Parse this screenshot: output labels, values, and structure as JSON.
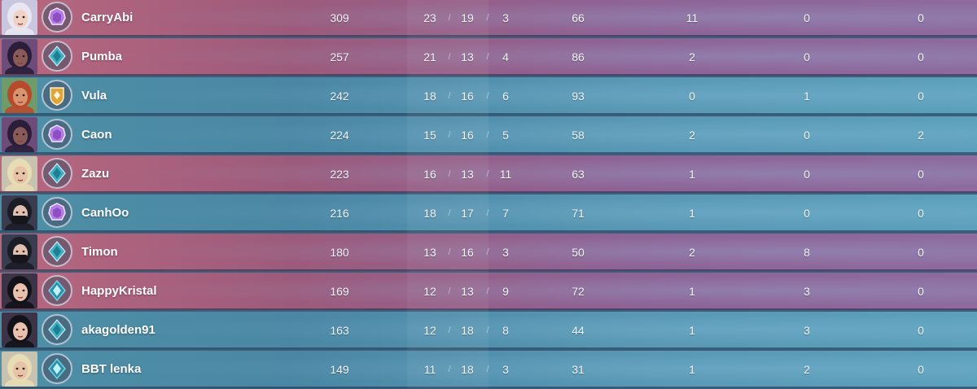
{
  "scoreboard": {
    "players": [
      {
        "name": "CarryAbi",
        "team": "red",
        "rank_icon": "amethyst-rank-icon",
        "agent_icon": "agent-portrait-silver-hair",
        "score": "309",
        "kills": "23",
        "deaths": "19",
        "assists": "3",
        "econ": "66",
        "first_bloods": "11",
        "plants": "0",
        "defuses": "0"
      },
      {
        "name": "Pumba",
        "team": "red",
        "rank_icon": "platinum-rank-icon",
        "agent_icon": "agent-portrait-dark-hair",
        "score": "257",
        "kills": "21",
        "deaths": "13",
        "assists": "4",
        "econ": "86",
        "first_bloods": "2",
        "plants": "0",
        "defuses": "0"
      },
      {
        "name": "Vula",
        "team": "blue",
        "rank_icon": "gold-rank-icon",
        "agent_icon": "agent-portrait-red-hair",
        "score": "242",
        "kills": "18",
        "deaths": "16",
        "assists": "6",
        "econ": "93",
        "first_bloods": "0",
        "plants": "1",
        "defuses": "0"
      },
      {
        "name": "Caon",
        "team": "blue",
        "rank_icon": "amethyst-rank-icon",
        "agent_icon": "agent-portrait-dark-hair",
        "score": "224",
        "kills": "15",
        "deaths": "16",
        "assists": "5",
        "econ": "58",
        "first_bloods": "2",
        "plants": "0",
        "defuses": "2"
      },
      {
        "name": "Zazu",
        "team": "red",
        "rank_icon": "platinum-rank-icon",
        "agent_icon": "agent-portrait-blonde-hair",
        "score": "223",
        "kills": "16",
        "deaths": "13",
        "assists": "11",
        "econ": "63",
        "first_bloods": "1",
        "plants": "0",
        "defuses": "0"
      },
      {
        "name": "CanhOo",
        "team": "blue",
        "rank_icon": "amethyst-rank-icon",
        "agent_icon": "agent-portrait-masked",
        "score": "216",
        "kills": "18",
        "deaths": "17",
        "assists": "7",
        "econ": "71",
        "first_bloods": "1",
        "plants": "0",
        "defuses": "0"
      },
      {
        "name": "Timon",
        "team": "red",
        "rank_icon": "platinum-rank-icon",
        "agent_icon": "agent-portrait-masked",
        "score": "180",
        "kills": "13",
        "deaths": "16",
        "assists": "3",
        "econ": "50",
        "first_bloods": "2",
        "plants": "8",
        "defuses": "0"
      },
      {
        "name": "HappyKristal",
        "team": "red",
        "rank_icon": "diamond-rank-icon",
        "agent_icon": "agent-portrait-black-hair",
        "score": "169",
        "kills": "12",
        "deaths": "13",
        "assists": "9",
        "econ": "72",
        "first_bloods": "1",
        "plants": "3",
        "defuses": "0"
      },
      {
        "name": "akagolden91",
        "team": "blue",
        "rank_icon": "platinum-rank-icon",
        "agent_icon": "agent-portrait-black-hair",
        "score": "163",
        "kills": "12",
        "deaths": "18",
        "assists": "8",
        "econ": "44",
        "first_bloods": "1",
        "plants": "3",
        "defuses": "0"
      },
      {
        "name": "BBT lenka",
        "team": "blue",
        "rank_icon": "diamond-rank-icon",
        "agent_icon": "agent-portrait-blonde-hair",
        "score": "149",
        "kills": "11",
        "deaths": "18",
        "assists": "3",
        "econ": "31",
        "first_bloods": "1",
        "plants": "2",
        "defuses": "0"
      }
    ],
    "kda_separator": "/",
    "colors": {
      "red_team": "#a8627e",
      "blue_team": "#4f8fa6",
      "amethyst": "#b57ce6",
      "platinum": "#3fb0c4",
      "gold": "#e0a53a",
      "diamond": "#6fd3e0"
    }
  }
}
